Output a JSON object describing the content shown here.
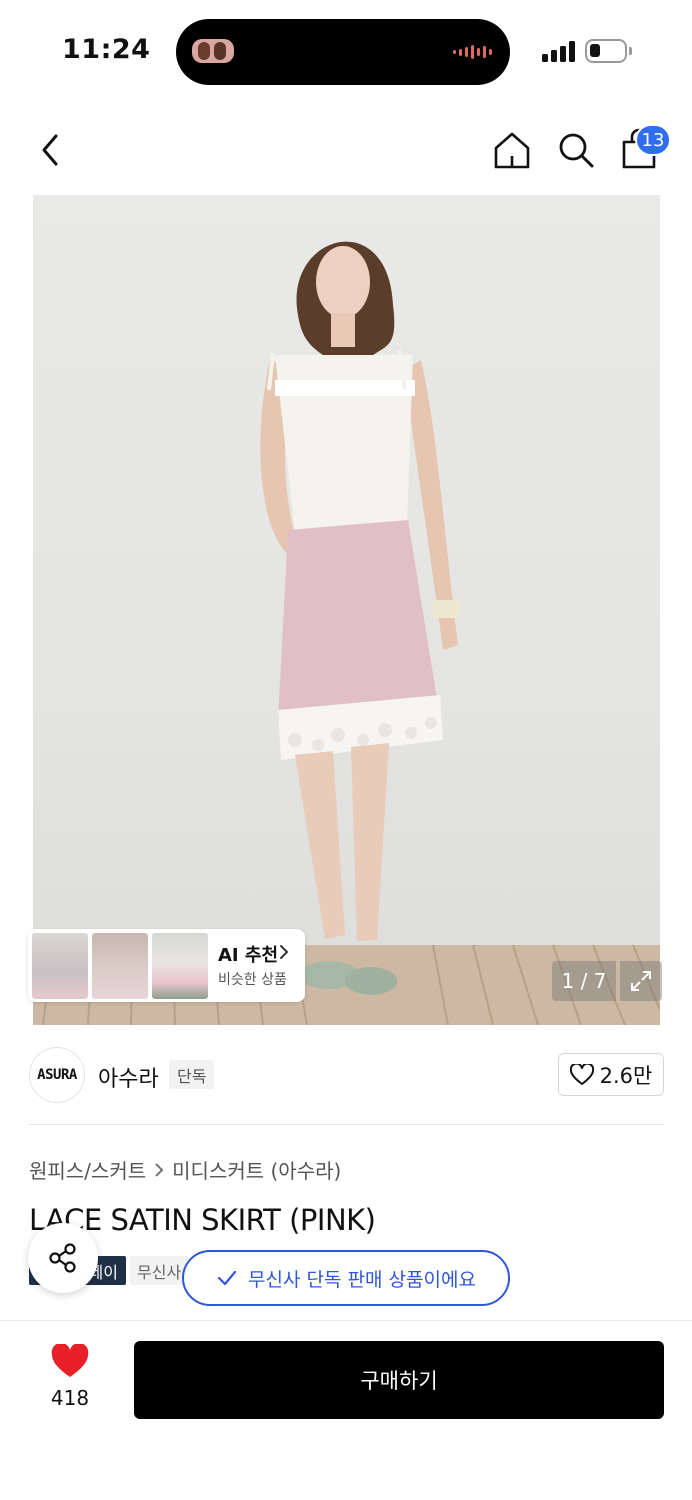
{
  "status_bar": {
    "time": "11:24"
  },
  "header": {
    "cart_count": "13"
  },
  "gallery": {
    "counter": "1 / 7",
    "ai_title": "AI 추천",
    "ai_subtitle": "비슷한 상품"
  },
  "brand": {
    "logo_text": "ASURA",
    "name": "아수라",
    "badge": "단독",
    "likes": "2.6만"
  },
  "breadcrumb": {
    "category": "원피스/스커트",
    "subcategory": "미디스커트 (아수라)"
  },
  "product": {
    "title": "LACE SATIN SKIRT (PINK)",
    "tag_dark": "레이",
    "tag_light": "무신사",
    "exclusive_notice": "무신사 단독 판매 상품이에요"
  },
  "bottom_bar": {
    "like_count": "418",
    "buy_label": "구매하기"
  },
  "colors": {
    "accent_blue": "#2f57d8",
    "badge_blue": "#2f6ef0",
    "heart_red": "#e8202a",
    "buy_button": "#000000"
  }
}
